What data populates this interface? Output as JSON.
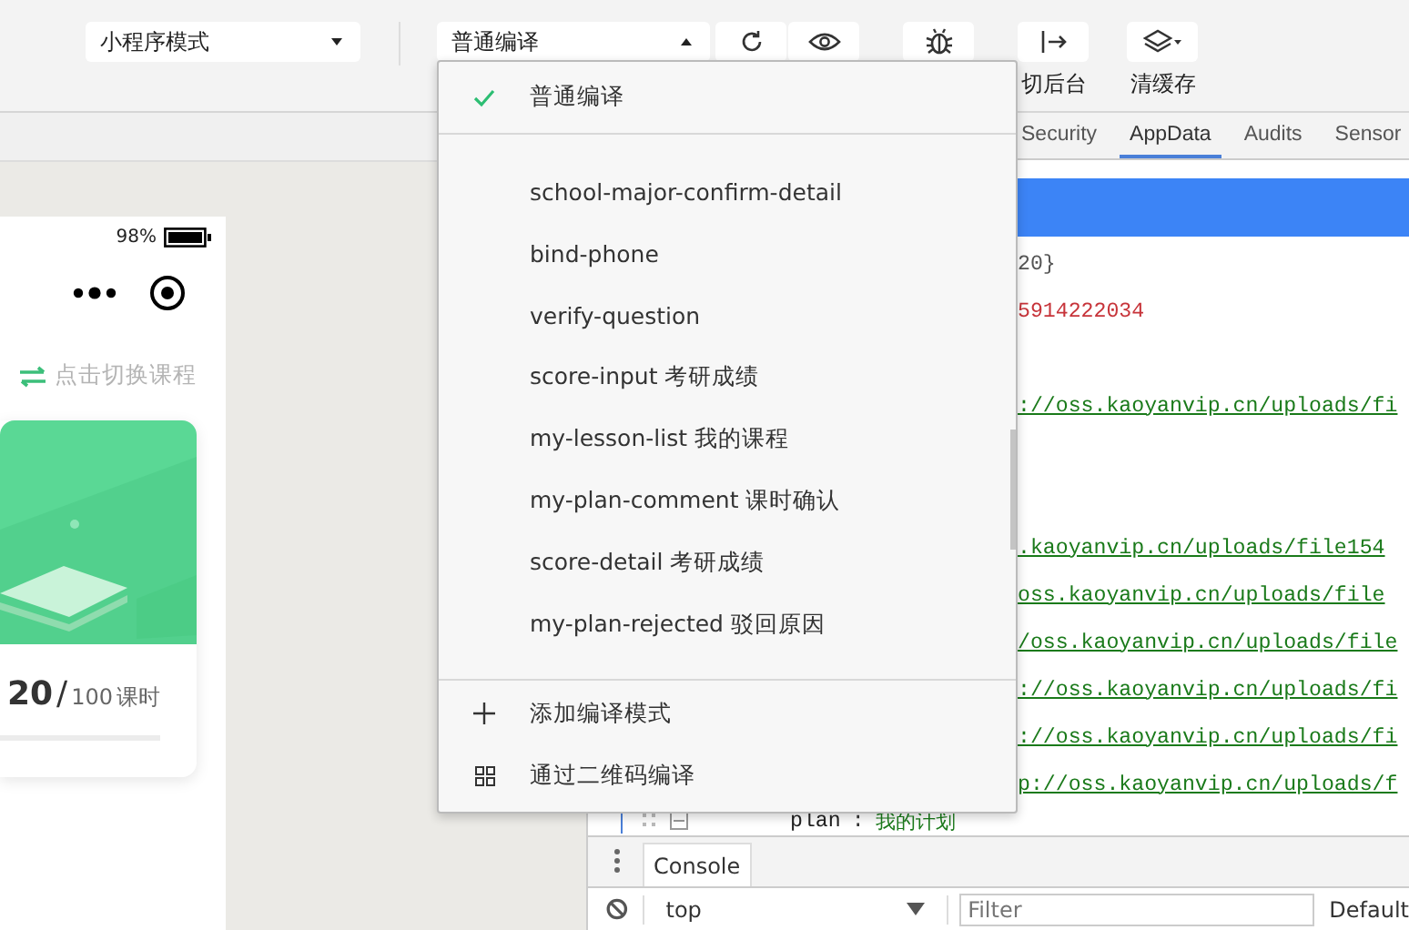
{
  "toolbar": {
    "mode_select": {
      "value": "小程序模式"
    },
    "compile_select": {
      "value": "普通编译",
      "expanded": true
    },
    "actions": [
      {
        "kind": "background",
        "label": "切后台"
      },
      {
        "kind": "cache",
        "label": "清缓存"
      }
    ]
  },
  "simulator": {
    "battery": "98%",
    "switch_course": "点击切换课程",
    "progress": {
      "done": "20",
      "separator": "/",
      "total": "100",
      "unit": "课时"
    }
  },
  "devtools": {
    "tabs": [
      {
        "label": "Security",
        "selected": false
      },
      {
        "label": "AppData",
        "selected": true
      },
      {
        "label": "Audits",
        "selected": false
      },
      {
        "label": "Sensor",
        "selected": false
      }
    ],
    "lines": [
      {
        "kind": "plain",
        "text": "20}"
      },
      {
        "kind": "number",
        "text": "5914222034"
      },
      {
        "kind": "hidden"
      },
      {
        "kind": "link",
        "text": "://oss.kaoyanvip.cn/uploads/fi"
      },
      {
        "kind": "hidden"
      },
      {
        "kind": "hidden"
      },
      {
        "kind": "link",
        "text": ".kaoyanvip.cn/uploads/file154"
      },
      {
        "kind": "link",
        "text": "oss.kaoyanvip.cn/uploads/file"
      },
      {
        "kind": "link",
        "text": "/oss.kaoyanvip.cn/uploads/file"
      },
      {
        "kind": "link",
        "text": "://oss.kaoyanvip.cn/uploads/fi"
      },
      {
        "kind": "link",
        "text": "://oss.kaoyanvip.cn/uploads/fi"
      },
      {
        "kind": "link",
        "text": "p://oss.kaoyanvip.cn/uploads/f"
      }
    ],
    "last_line": {
      "key": "plan",
      "separator": ":",
      "value": "我的计划"
    }
  },
  "console": {
    "tab": "Console",
    "context": "top",
    "filter_placeholder": "Filter",
    "levels": "Default"
  },
  "compile_menu": {
    "current": {
      "label": "普通编译",
      "selected": true
    },
    "items": [
      {
        "label": "school-major-confirm-detail"
      },
      {
        "label": "bind-phone"
      },
      {
        "label": "verify-question"
      },
      {
        "label": "score-input 考研成绩"
      },
      {
        "label": "my-lesson-list 我的课程"
      },
      {
        "label": "my-plan-comment 课时确认"
      },
      {
        "label": "score-detail 考研成绩"
      },
      {
        "label": "my-plan-rejected 驳回原因"
      }
    ],
    "footer": [
      {
        "kind": "add",
        "label": "添加编译模式"
      },
      {
        "kind": "qrcode",
        "label": "通过二维码编译"
      }
    ]
  }
}
